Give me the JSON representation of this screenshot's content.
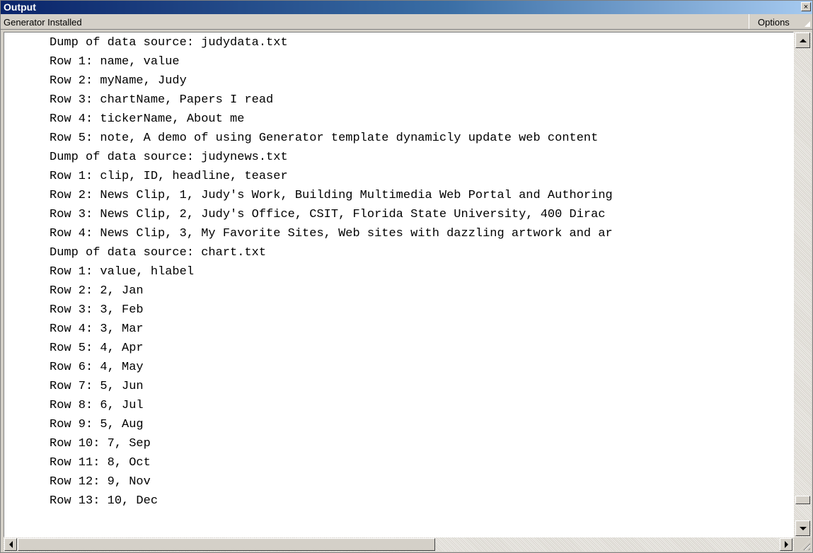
{
  "window": {
    "title": "Output",
    "close_glyph": "×"
  },
  "toolbar": {
    "status": "Generator Installed",
    "options_label": "Options"
  },
  "output": {
    "lines": [
      "Dump of data source: judydata.txt",
      "Row 1: name, value",
      "Row 2: myName, Judy",
      "Row 3: chartName, Papers I read",
      "Row 4: tickerName, About me",
      "Row 5: note, A demo of using Generator template dynamicly update web content",
      "Dump of data source: judynews.txt",
      "Row 1: clip, ID, headline, teaser",
      "Row 2: News Clip, 1, Judy's Work, Building Multimedia Web Portal and Authoring",
      "Row 3: News Clip, 2, Judy's Office, CSIT, Florida State University, 400 Dirac",
      "Row 4: News Clip, 3, My Favorite Sites, Web sites with dazzling artwork and ar",
      "Dump of data source: chart.txt",
      "Row 1: value, hlabel",
      "Row 2: 2, Jan",
      "Row 3: 3, Feb",
      "Row 4: 3, Mar",
      "Row 5: 4, Apr",
      "Row 6: 4, May",
      "Row 7: 5, Jun",
      "Row 8: 6, Jul",
      "Row 9: 5, Aug",
      "Row 10: 7, Sep",
      "Row 11: 8, Oct",
      "Row 12: 9, Nov",
      "Row 13: 10, Dec"
    ]
  },
  "scrollbars": {
    "vertical_position": 0.97,
    "horizontal_position": 0.0
  },
  "colors": {
    "titlebar_start": "#0a246a",
    "titlebar_end": "#a6caf0",
    "chrome": "#d4d0c8",
    "content_bg": "#ffffff"
  }
}
